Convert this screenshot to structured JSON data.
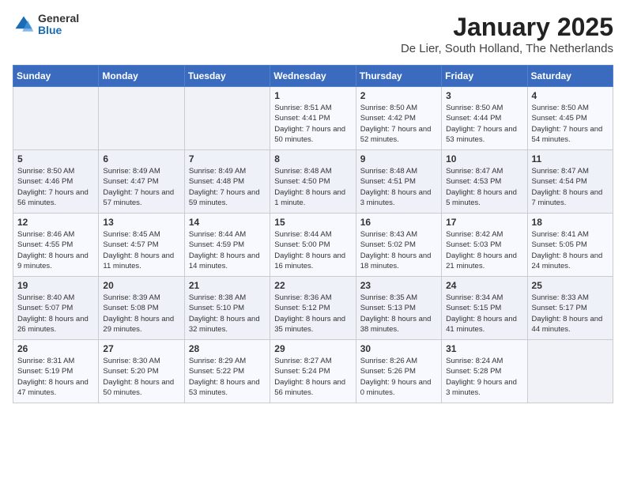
{
  "logo": {
    "general": "General",
    "blue": "Blue"
  },
  "header": {
    "month": "January 2025",
    "location": "De Lier, South Holland, The Netherlands"
  },
  "weekdays": [
    "Sunday",
    "Monday",
    "Tuesday",
    "Wednesday",
    "Thursday",
    "Friday",
    "Saturday"
  ],
  "weeks": [
    [
      {
        "day": "",
        "sunrise": "",
        "sunset": "",
        "daylight": ""
      },
      {
        "day": "",
        "sunrise": "",
        "sunset": "",
        "daylight": ""
      },
      {
        "day": "",
        "sunrise": "",
        "sunset": "",
        "daylight": ""
      },
      {
        "day": "1",
        "sunrise": "Sunrise: 8:51 AM",
        "sunset": "Sunset: 4:41 PM",
        "daylight": "Daylight: 7 hours and 50 minutes."
      },
      {
        "day": "2",
        "sunrise": "Sunrise: 8:50 AM",
        "sunset": "Sunset: 4:42 PM",
        "daylight": "Daylight: 7 hours and 52 minutes."
      },
      {
        "day": "3",
        "sunrise": "Sunrise: 8:50 AM",
        "sunset": "Sunset: 4:44 PM",
        "daylight": "Daylight: 7 hours and 53 minutes."
      },
      {
        "day": "4",
        "sunrise": "Sunrise: 8:50 AM",
        "sunset": "Sunset: 4:45 PM",
        "daylight": "Daylight: 7 hours and 54 minutes."
      }
    ],
    [
      {
        "day": "5",
        "sunrise": "Sunrise: 8:50 AM",
        "sunset": "Sunset: 4:46 PM",
        "daylight": "Daylight: 7 hours and 56 minutes."
      },
      {
        "day": "6",
        "sunrise": "Sunrise: 8:49 AM",
        "sunset": "Sunset: 4:47 PM",
        "daylight": "Daylight: 7 hours and 57 minutes."
      },
      {
        "day": "7",
        "sunrise": "Sunrise: 8:49 AM",
        "sunset": "Sunset: 4:48 PM",
        "daylight": "Daylight: 7 hours and 59 minutes."
      },
      {
        "day": "8",
        "sunrise": "Sunrise: 8:48 AM",
        "sunset": "Sunset: 4:50 PM",
        "daylight": "Daylight: 8 hours and 1 minute."
      },
      {
        "day": "9",
        "sunrise": "Sunrise: 8:48 AM",
        "sunset": "Sunset: 4:51 PM",
        "daylight": "Daylight: 8 hours and 3 minutes."
      },
      {
        "day": "10",
        "sunrise": "Sunrise: 8:47 AM",
        "sunset": "Sunset: 4:53 PM",
        "daylight": "Daylight: 8 hours and 5 minutes."
      },
      {
        "day": "11",
        "sunrise": "Sunrise: 8:47 AM",
        "sunset": "Sunset: 4:54 PM",
        "daylight": "Daylight: 8 hours and 7 minutes."
      }
    ],
    [
      {
        "day": "12",
        "sunrise": "Sunrise: 8:46 AM",
        "sunset": "Sunset: 4:55 PM",
        "daylight": "Daylight: 8 hours and 9 minutes."
      },
      {
        "day": "13",
        "sunrise": "Sunrise: 8:45 AM",
        "sunset": "Sunset: 4:57 PM",
        "daylight": "Daylight: 8 hours and 11 minutes."
      },
      {
        "day": "14",
        "sunrise": "Sunrise: 8:44 AM",
        "sunset": "Sunset: 4:59 PM",
        "daylight": "Daylight: 8 hours and 14 minutes."
      },
      {
        "day": "15",
        "sunrise": "Sunrise: 8:44 AM",
        "sunset": "Sunset: 5:00 PM",
        "daylight": "Daylight: 8 hours and 16 minutes."
      },
      {
        "day": "16",
        "sunrise": "Sunrise: 8:43 AM",
        "sunset": "Sunset: 5:02 PM",
        "daylight": "Daylight: 8 hours and 18 minutes."
      },
      {
        "day": "17",
        "sunrise": "Sunrise: 8:42 AM",
        "sunset": "Sunset: 5:03 PM",
        "daylight": "Daylight: 8 hours and 21 minutes."
      },
      {
        "day": "18",
        "sunrise": "Sunrise: 8:41 AM",
        "sunset": "Sunset: 5:05 PM",
        "daylight": "Daylight: 8 hours and 24 minutes."
      }
    ],
    [
      {
        "day": "19",
        "sunrise": "Sunrise: 8:40 AM",
        "sunset": "Sunset: 5:07 PM",
        "daylight": "Daylight: 8 hours and 26 minutes."
      },
      {
        "day": "20",
        "sunrise": "Sunrise: 8:39 AM",
        "sunset": "Sunset: 5:08 PM",
        "daylight": "Daylight: 8 hours and 29 minutes."
      },
      {
        "day": "21",
        "sunrise": "Sunrise: 8:38 AM",
        "sunset": "Sunset: 5:10 PM",
        "daylight": "Daylight: 8 hours and 32 minutes."
      },
      {
        "day": "22",
        "sunrise": "Sunrise: 8:36 AM",
        "sunset": "Sunset: 5:12 PM",
        "daylight": "Daylight: 8 hours and 35 minutes."
      },
      {
        "day": "23",
        "sunrise": "Sunrise: 8:35 AM",
        "sunset": "Sunset: 5:13 PM",
        "daylight": "Daylight: 8 hours and 38 minutes."
      },
      {
        "day": "24",
        "sunrise": "Sunrise: 8:34 AM",
        "sunset": "Sunset: 5:15 PM",
        "daylight": "Daylight: 8 hours and 41 minutes."
      },
      {
        "day": "25",
        "sunrise": "Sunrise: 8:33 AM",
        "sunset": "Sunset: 5:17 PM",
        "daylight": "Daylight: 8 hours and 44 minutes."
      }
    ],
    [
      {
        "day": "26",
        "sunrise": "Sunrise: 8:31 AM",
        "sunset": "Sunset: 5:19 PM",
        "daylight": "Daylight: 8 hours and 47 minutes."
      },
      {
        "day": "27",
        "sunrise": "Sunrise: 8:30 AM",
        "sunset": "Sunset: 5:20 PM",
        "daylight": "Daylight: 8 hours and 50 minutes."
      },
      {
        "day": "28",
        "sunrise": "Sunrise: 8:29 AM",
        "sunset": "Sunset: 5:22 PM",
        "daylight": "Daylight: 8 hours and 53 minutes."
      },
      {
        "day": "29",
        "sunrise": "Sunrise: 8:27 AM",
        "sunset": "Sunset: 5:24 PM",
        "daylight": "Daylight: 8 hours and 56 minutes."
      },
      {
        "day": "30",
        "sunrise": "Sunrise: 8:26 AM",
        "sunset": "Sunset: 5:26 PM",
        "daylight": "Daylight: 9 hours and 0 minutes."
      },
      {
        "day": "31",
        "sunrise": "Sunrise: 8:24 AM",
        "sunset": "Sunset: 5:28 PM",
        "daylight": "Daylight: 9 hours and 3 minutes."
      },
      {
        "day": "",
        "sunrise": "",
        "sunset": "",
        "daylight": ""
      }
    ]
  ]
}
